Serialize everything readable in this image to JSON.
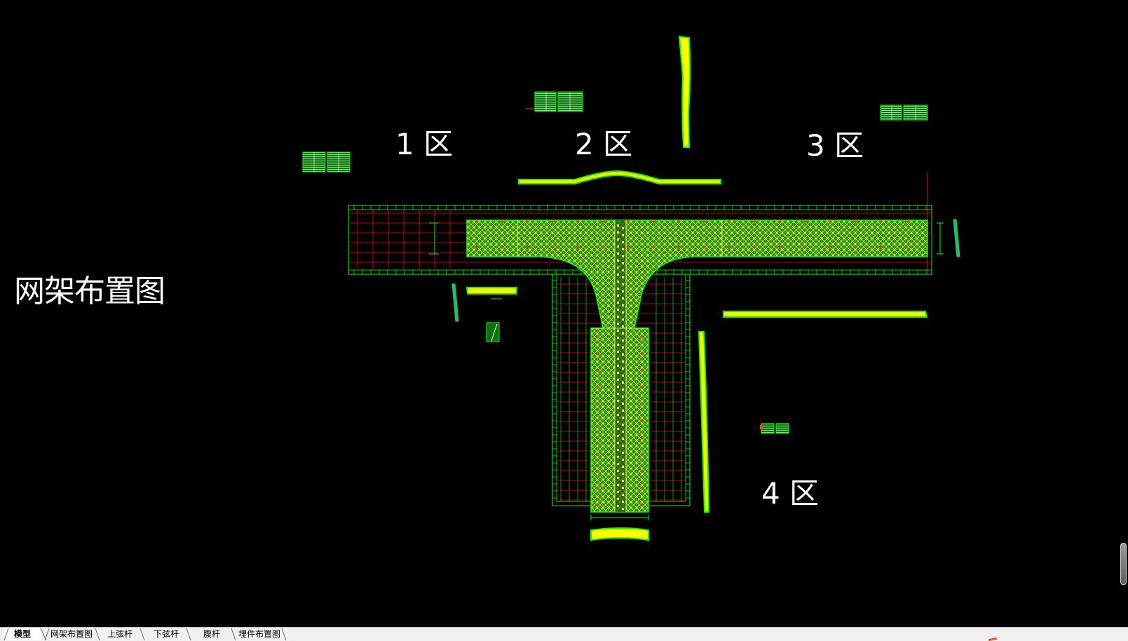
{
  "drawing": {
    "sheet_title": "网架布置图",
    "zones": [
      {
        "label": "1 区"
      },
      {
        "label": "2 区"
      },
      {
        "label": "3 区"
      },
      {
        "label": "4 区"
      }
    ]
  },
  "colors": {
    "background": "#000000",
    "grid_green": "#00ff00",
    "axis_red": "#ff0000",
    "highlight_yellow": "#ffff00",
    "text_white": "#ffffff",
    "tab_bar": "#f0f0f0"
  },
  "tabs": [
    {
      "label": "模型",
      "active": true
    },
    {
      "label": "网架布置图",
      "active": false
    },
    {
      "label": "上弦杆",
      "active": false
    },
    {
      "label": "下弦杆",
      "active": false
    },
    {
      "label": "腹杆",
      "active": false
    },
    {
      "label": "埋件布置图",
      "active": false
    }
  ]
}
